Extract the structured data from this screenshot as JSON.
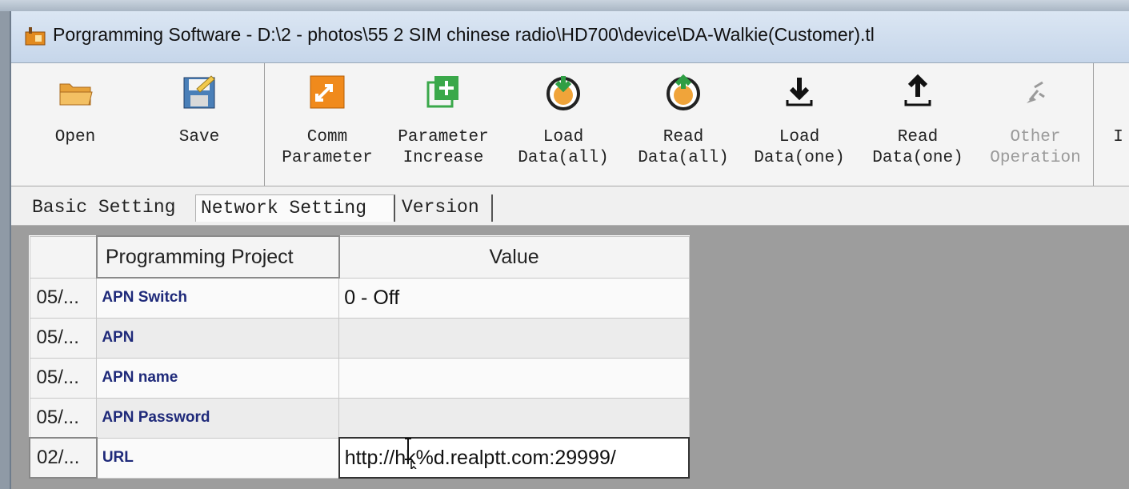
{
  "window": {
    "title": "Porgramming Software - D:\\2 - photos\\55 2 SIM chinese radio\\HD700\\device\\DA-Walkie(Customer).tl"
  },
  "toolbar": {
    "open": "Open",
    "save": "Save",
    "comm": "Comm\nParameter",
    "param_increase": "Parameter\nIncrease",
    "load_all": "Load\nData(all)",
    "read_all": "Read\nData(all)",
    "load_one": "Load\nData(one)",
    "read_one": "Read\nData(one)",
    "other": "Other\nOperation",
    "partial": "I"
  },
  "tabs": [
    "Basic Setting",
    "Network Setting",
    "Version"
  ],
  "grid": {
    "headers": [
      "",
      "Programming Project",
      "Value"
    ],
    "rows": [
      {
        "id": "05/...",
        "project": "APN Switch",
        "value": "0 - Off"
      },
      {
        "id": "05/...",
        "project": "APN",
        "value": ""
      },
      {
        "id": "05/...",
        "project": "APN name",
        "value": ""
      },
      {
        "id": "05/...",
        "project": "APN Password",
        "value": ""
      },
      {
        "id": "02/...",
        "project": "URL",
        "value": "http://hk%d.realptt.com:29999/"
      }
    ]
  },
  "colors": {
    "accent_orange": "#f08a1c",
    "accent_green": "#3aa84a",
    "project_text": "#1f2a7a"
  }
}
